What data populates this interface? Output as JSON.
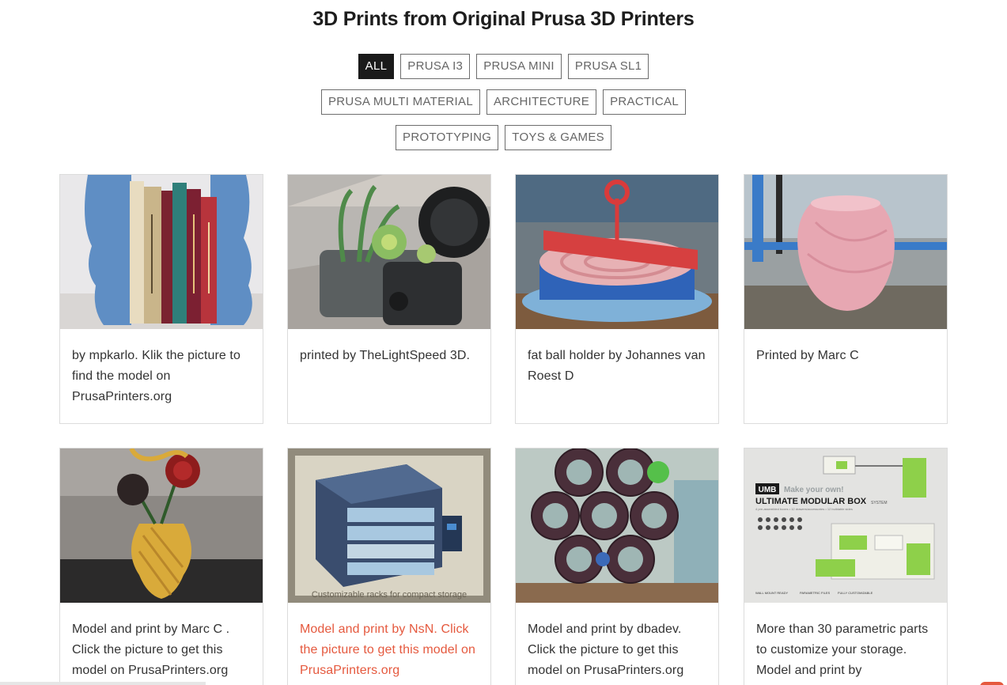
{
  "page": {
    "title": "3D Prints from Original Prusa 3D Printers"
  },
  "filters": {
    "row1": [
      "ALL",
      "PRUSA I3",
      "PRUSA MINI",
      "PRUSA SL1"
    ],
    "row2": [
      "PRUSA MULTI MATERIAL",
      "ARCHITECTURE",
      "PRACTICAL"
    ],
    "row3": [
      "PROTOTYPING",
      "TOYS & GAMES"
    ],
    "active": "ALL"
  },
  "cards": [
    {
      "caption": "by mpkarlo. Klik the picture to find the model on PrusaPrinters.org",
      "image": "blue-bookends-photo"
    },
    {
      "caption": "printed by TheLightSpeed 3D.",
      "image": "camera-planter-photo"
    },
    {
      "caption": "fat ball holder by Johannes van Roest D",
      "image": "fly-in-ball-holder-photo"
    },
    {
      "caption": "Printed by Marc C",
      "image": "pink-vase-photo"
    },
    {
      "caption": "Model and print by Marc C . Click the picture to get this model on PrusaPrinters.org",
      "image": "gold-vase-roses-photo"
    },
    {
      "caption": "Model and print by NsN. Click the picture to get this model on PrusaPrinters.org",
      "image": "storage-rack-photo",
      "image_text": "Customizable racks for compact storage"
    },
    {
      "caption": "Model and print by dbadev. Click the picture to get this model on PrusaPrinters.org",
      "image": "gear-wine-rack-photo"
    },
    {
      "caption": "More than 30 parametric parts to customize your storage. Model and print by",
      "image": "modular-box-photo",
      "image_text": {
        "brand": "UMB",
        "tagline": "Make your own!",
        "headline": "ULTIMATE MODULAR BOX",
        "system": "SYSTEM",
        "sub": "4 pre-assembled boxes • 12 drawers/accessories • 12 buildable sides",
        "feature1": "WALL MOUNT READY",
        "feature2": "PARAMETRIC FILES",
        "feature3": "FULLY CUSTOMIZABLE"
      }
    }
  ],
  "colors": {
    "accent": "#e5593e",
    "active_filter_bg": "#1a1a1a",
    "border": "#dcdcdc"
  }
}
